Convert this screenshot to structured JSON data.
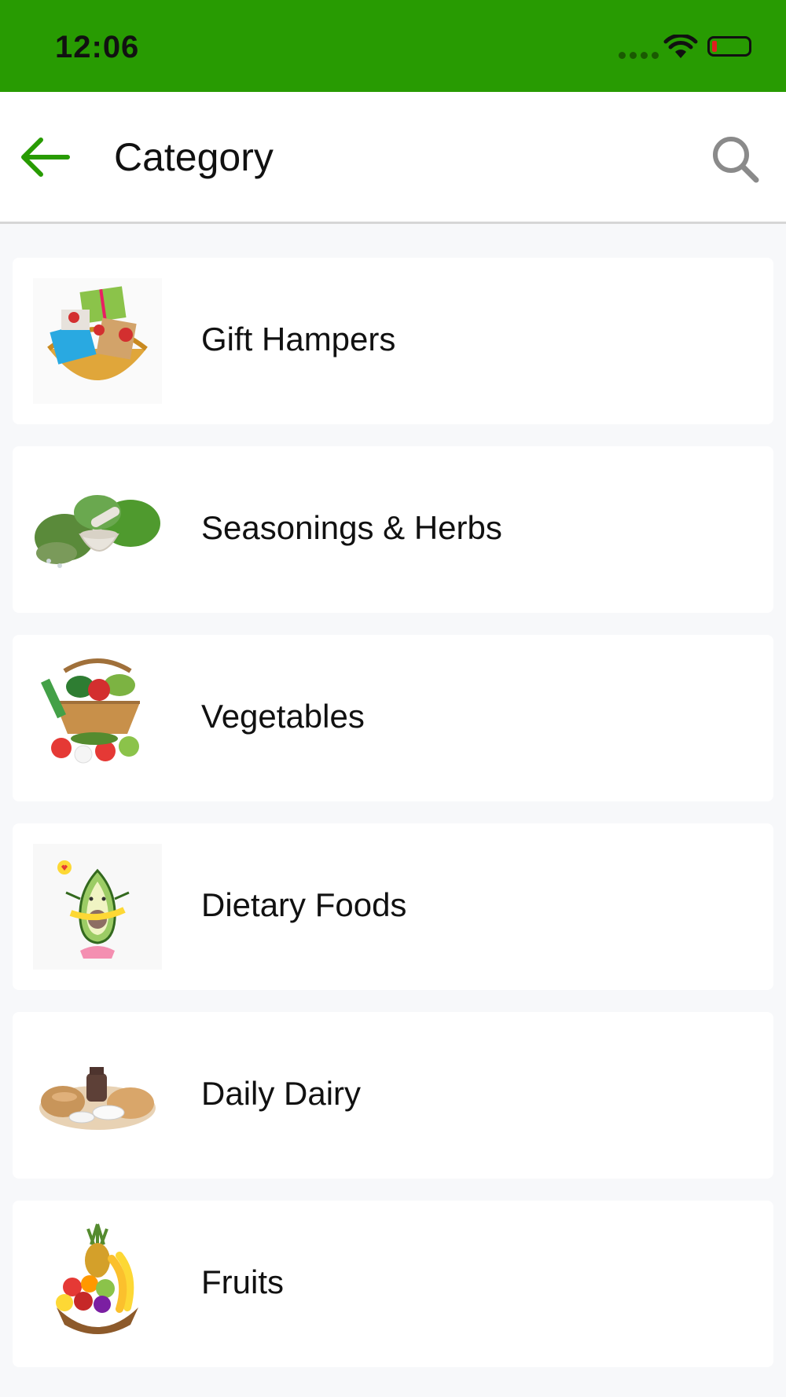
{
  "status_bar": {
    "time": "12:06",
    "icons": [
      "signal-icon",
      "wifi-icon",
      "battery-low-icon"
    ],
    "background": "#289b02"
  },
  "app_bar": {
    "title": "Category",
    "back_icon": "arrow-left-icon",
    "search_icon": "search-icon",
    "accent": "#289b02"
  },
  "categories": [
    {
      "label": "Gift Hampers",
      "icon": "gift-basket-icon"
    },
    {
      "label": "Seasonings & Herbs",
      "icon": "herbs-mortar-icon"
    },
    {
      "label": "Vegetables",
      "icon": "vegetable-basket-icon"
    },
    {
      "label": "Dietary Foods",
      "icon": "avocado-icon"
    },
    {
      "label": "Daily Dairy",
      "icon": "dairy-bread-icon"
    },
    {
      "label": "Fruits",
      "icon": "fruit-basket-icon"
    }
  ]
}
